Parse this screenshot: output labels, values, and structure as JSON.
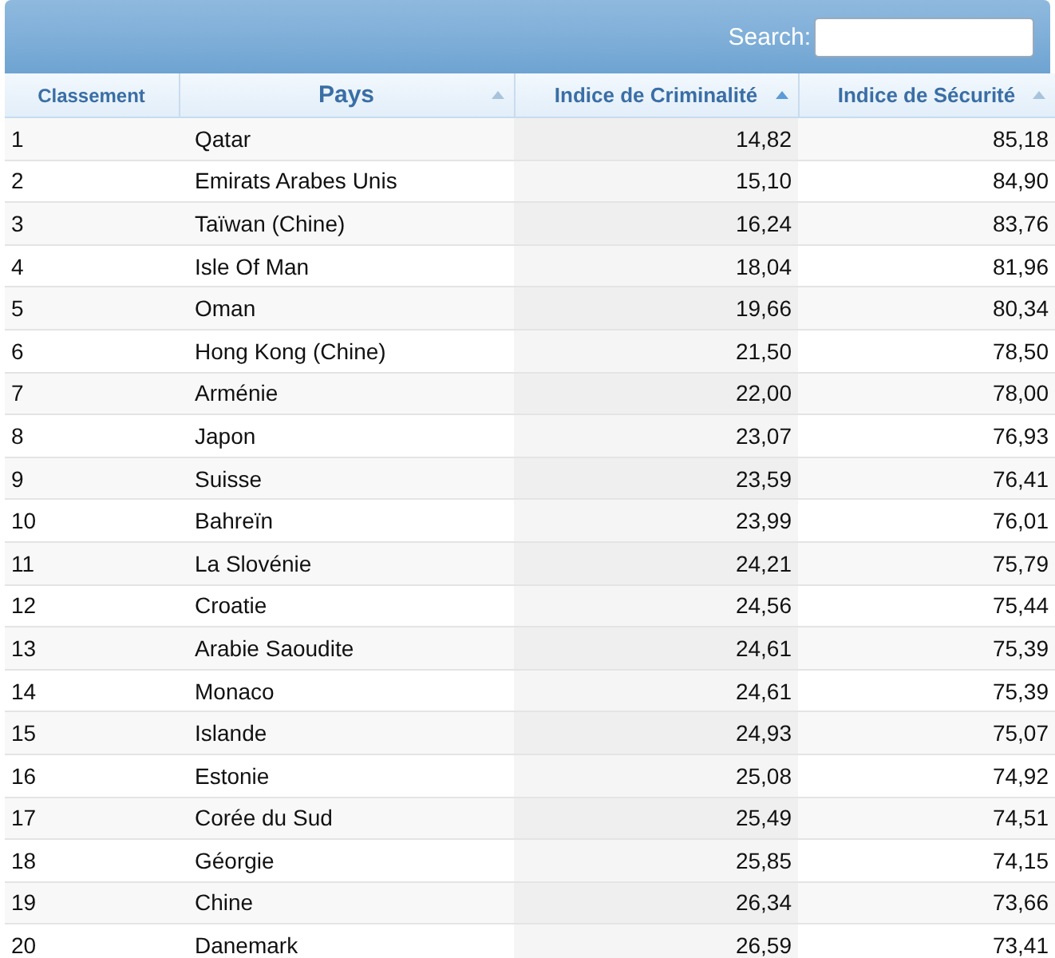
{
  "search": {
    "label": "Search:"
  },
  "table": {
    "columns": [
      {
        "label": "Classement",
        "kind": "rank",
        "sortable": false,
        "sorted": false
      },
      {
        "label": "Pays",
        "kind": "text",
        "sortable": true,
        "sorted": false
      },
      {
        "label": "Indice de Criminalité",
        "kind": "number",
        "sortable": true,
        "sorted": true
      },
      {
        "label": "Indice de Sécurité",
        "kind": "number",
        "sortable": true,
        "sorted": false
      }
    ],
    "rows": [
      [
        "1",
        "Qatar",
        "14,82",
        "85,18"
      ],
      [
        "2",
        "Emirats Arabes Unis",
        "15,10",
        "84,90"
      ],
      [
        "3",
        "Taïwan (Chine)",
        "16,24",
        "83,76"
      ],
      [
        "4",
        "Isle Of Man",
        "18,04",
        "81,96"
      ],
      [
        "5",
        "Oman",
        "19,66",
        "80,34"
      ],
      [
        "6",
        "Hong Kong (Chine)",
        "21,50",
        "78,50"
      ],
      [
        "7",
        "Arménie",
        "22,00",
        "78,00"
      ],
      [
        "8",
        "Japon",
        "23,07",
        "76,93"
      ],
      [
        "9",
        "Suisse",
        "23,59",
        "76,41"
      ],
      [
        "10",
        "Bahreïn",
        "23,99",
        "76,01"
      ],
      [
        "11",
        "La Slovénie",
        "24,21",
        "75,79"
      ],
      [
        "12",
        "Croatie",
        "24,56",
        "75,44"
      ],
      [
        "13",
        "Arabie Saoudite",
        "24,61",
        "75,39"
      ],
      [
        "14",
        "Monaco",
        "24,61",
        "75,39"
      ],
      [
        "15",
        "Islande",
        "24,93",
        "75,07"
      ],
      [
        "16",
        "Estonie",
        "25,08",
        "74,92"
      ],
      [
        "17",
        "Corée du Sud",
        "25,49",
        "74,51"
      ],
      [
        "18",
        "Géorgie",
        "25,85",
        "74,15"
      ],
      [
        "19",
        "Chine",
        "26,34",
        "73,66"
      ],
      [
        "20",
        "Danemark",
        "26,59",
        "73,41"
      ]
    ]
  }
}
